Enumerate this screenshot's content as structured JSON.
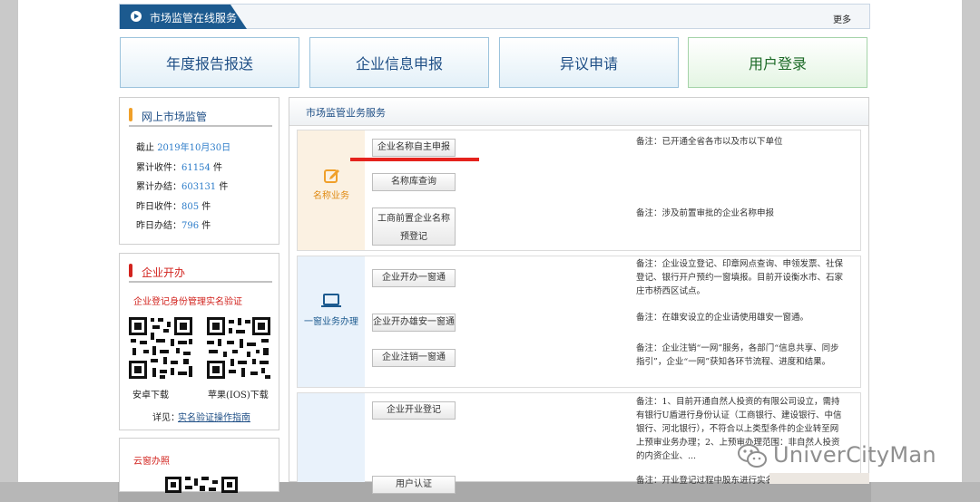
{
  "topbar": {
    "title": "市场监管在线服务",
    "more": "更多"
  },
  "quick_buttons": [
    {
      "label": "年度报告报送"
    },
    {
      "label": "企业信息申报"
    },
    {
      "label": "异议申请"
    },
    {
      "label": "用户登录"
    }
  ],
  "online_supervision": {
    "title": "网上市场监管",
    "stats": [
      {
        "label": "截止 ",
        "value": "2019年10月30日",
        "unit": ""
      },
      {
        "label": "累计收件：",
        "value": "61154",
        "unit": " 件"
      },
      {
        "label": "累计办结：",
        "value": "603131",
        "unit": " 件"
      },
      {
        "label": "昨日收件：",
        "value": "805",
        "unit": " 件"
      },
      {
        "label": "昨日办结：",
        "value": "796",
        "unit": " 件"
      }
    ]
  },
  "enterprise_open": {
    "title": "企业开办",
    "subtitle": "企业登记身份管理实名验证",
    "android_label": "安卓下载",
    "ios_label": "苹果(IOS)下载",
    "detail_prefix": "详见：",
    "detail_link": "实名验证操作指南"
  },
  "cloud_window": {
    "title": "云窗办照"
  },
  "main": {
    "title": "市场监管业务服务",
    "sections": [
      {
        "label": "名称业务",
        "icon": "edit-icon",
        "buttons": [
          "企业名称自主申报",
          "名称库查询",
          "工商前置企业名称预登记"
        ],
        "notes": [
          "备注：已开通全省各市以及市以下单位",
          "备注：涉及前置审批的企业名称申报"
        ]
      },
      {
        "label": "一窗业务办理",
        "icon": "laptop-icon",
        "buttons": [
          "企业开办一窗通",
          "企业开办雄安一窗通",
          "企业注销一窗通"
        ],
        "notes": [
          "备注：企业设立登记、印章网点查询、申领发票、社保登记、银行开户预约一窗填报。目前开设衡水市、石家庄市桥西区试点。",
          "备注：在雄安设立的企业请使用雄安一窗通。",
          "备注：企业注销“一网”服务，各部门“信息共享、同步指引”，企业“一网”获知各环节流程、进度和结果。"
        ]
      },
      {
        "label": "",
        "buttons": [
          "企业开业登记",
          "用户认证"
        ],
        "notes": [
          "备注：1、目前开通自然人投资的有限公司设立，需持有银行U盾进行身份认证（工商银行、建设银行、中信银行、河北银行），不符合以上类型条件的企业转至网上预审业务办理；2、上预审办理范围：非自然人投资的内资企业、...",
          "备注：开业登记过程中股东进行实名认证"
        ]
      }
    ]
  },
  "watermark": "UniverCityMan",
  "colors": {
    "brand_blue": "#1c5a8f",
    "link_blue": "#2c7cc9",
    "accent_red": "#e5231d",
    "orange": "#f0a02a"
  }
}
